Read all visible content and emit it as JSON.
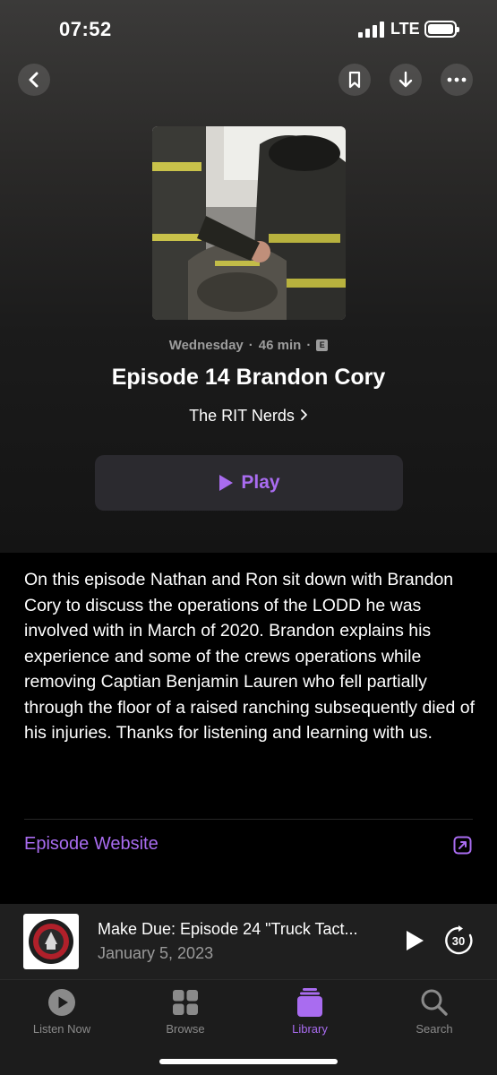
{
  "status_bar": {
    "time": "07:52",
    "network": "LTE"
  },
  "nav": {
    "back_icon": "chevron-left-icon",
    "bookmark_icon": "bookmark-icon",
    "download_icon": "download-arrow-icon",
    "more_icon": "ellipsis-icon"
  },
  "episode": {
    "day": "Wednesday",
    "duration": "46 min",
    "explicit_badge": "E",
    "title": "Episode 14 Brandon Cory",
    "show_name": "The RIT Nerds",
    "play_label": "Play",
    "description": "On this episode Nathan and Ron sit down with Brandon Cory to discuss the operations of the LODD he was involved with in March of 2020. Brandon explains his experience and some of the crews operations while removing Captian Benjamin Lauren who fell partially through the floor of a raised ranching subsequently died of his injuries. Thanks for listening and learning with us.",
    "website_label": "Episode Website"
  },
  "mini_player": {
    "title": "Make Due: Episode 24 \"Truck Tact...",
    "date": "January 5, 2023",
    "skip_seconds": "30"
  },
  "tabs": [
    {
      "label": "Listen Now",
      "icon": "play-circle-icon",
      "active": false
    },
    {
      "label": "Browse",
      "icon": "grid-icon",
      "active": false
    },
    {
      "label": "Library",
      "icon": "library-stack-icon",
      "active": true
    },
    {
      "label": "Search",
      "icon": "magnifier-icon",
      "active": false
    }
  ],
  "colors": {
    "accent": "#a96cf0",
    "background": "#000000",
    "mini_player_bg": "#1f1f1f",
    "tab_bar_bg": "#1c1c1c"
  }
}
